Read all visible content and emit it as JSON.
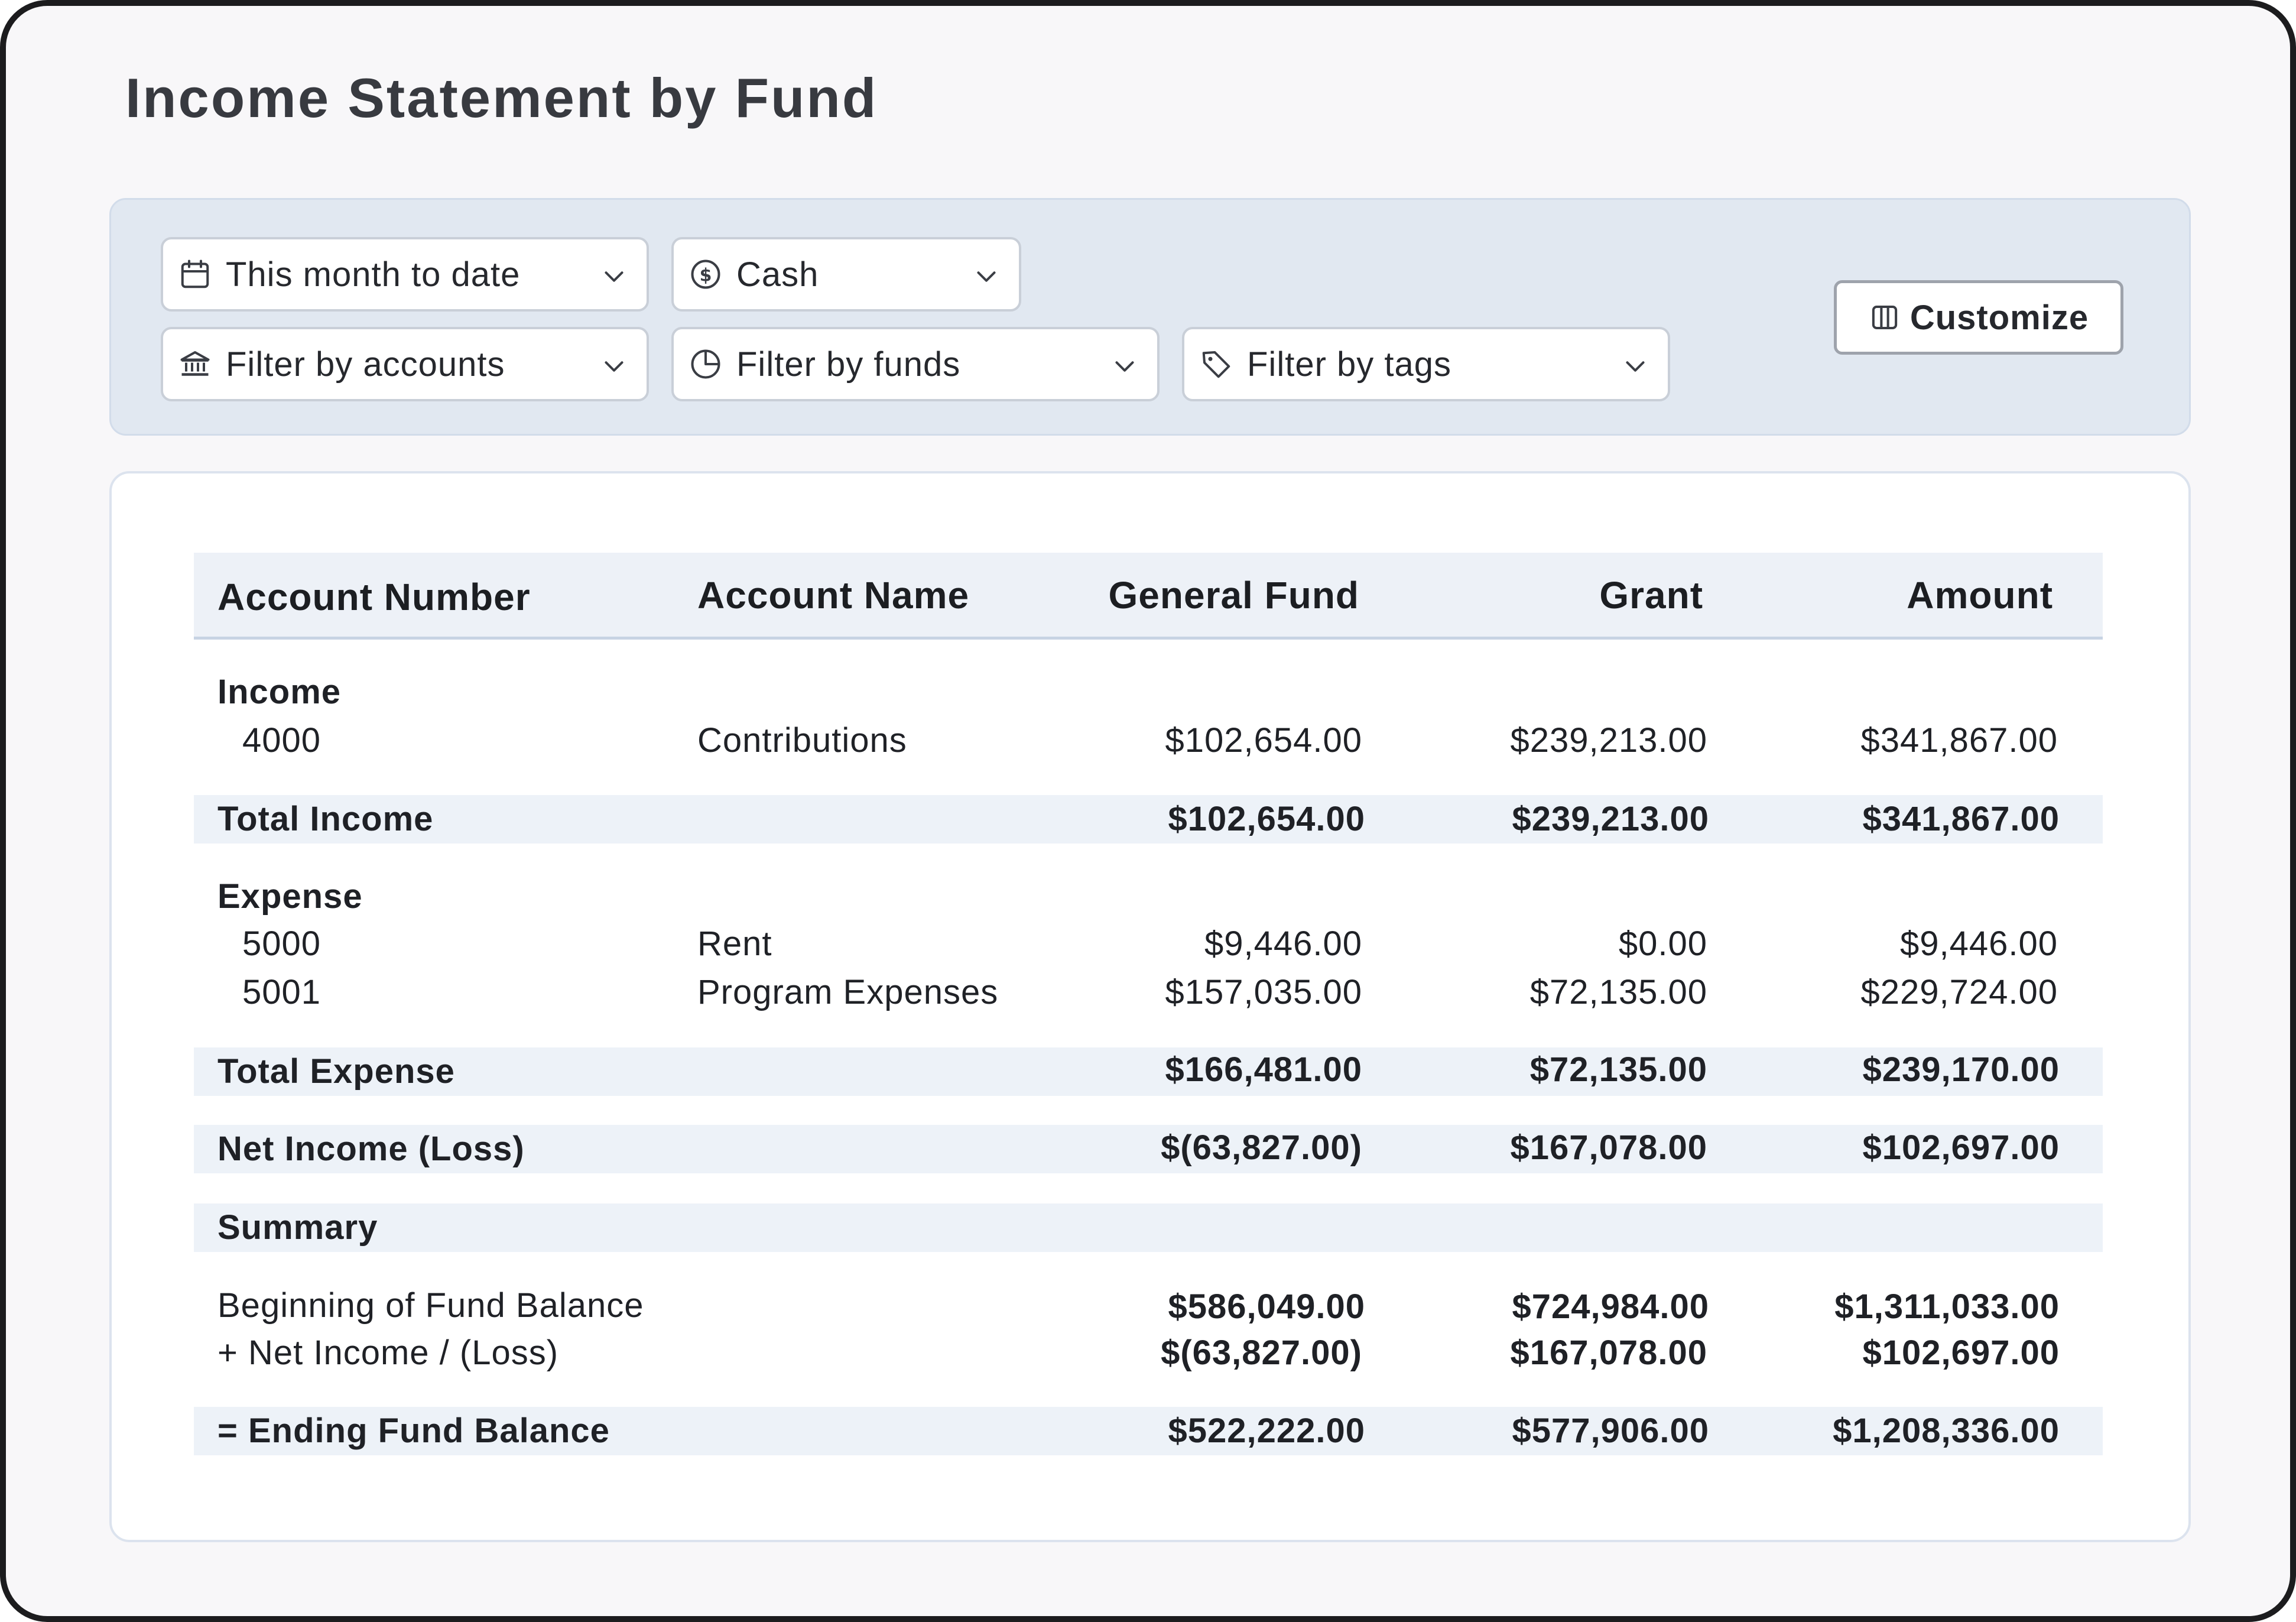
{
  "page_title": "Income Statement by Fund",
  "filters": {
    "date_range": "This month to date",
    "basis": "Cash",
    "accounts": "Filter by accounts",
    "funds": "Filter by funds",
    "tags": "Filter by tags"
  },
  "customize_label": "Customize",
  "table": {
    "headers": {
      "account_number": "Account Number",
      "account_name": "Account Name",
      "general_fund": "General Fund",
      "grant": "Grant",
      "amount": "Amount"
    },
    "income": {
      "label": "Income",
      "rows": [
        {
          "number": "4000",
          "name": "Contributions",
          "general_fund": "$102,654.00",
          "grant": "$239,213.00",
          "amount": "$341,867.00"
        }
      ],
      "total": {
        "label": "Total Income",
        "general_fund": "$102,654.00",
        "grant": "$239,213.00",
        "amount": "$341,867.00"
      }
    },
    "expense": {
      "label": "Expense",
      "rows": [
        {
          "number": "5000",
          "name": "Rent",
          "general_fund": "$9,446.00",
          "grant": "$0.00",
          "amount": "$9,446.00"
        },
        {
          "number": "5001",
          "name": "Program Expenses",
          "general_fund": "$157,035.00",
          "grant": "$72,135.00",
          "amount": "$229,724.00"
        }
      ],
      "total": {
        "label": "Total Expense",
        "general_fund": "$166,481.00",
        "grant": "$72,135.00",
        "amount": "$239,170.00"
      }
    },
    "net_income": {
      "label": "Net Income (Loss)",
      "general_fund": "$(63,827.00)",
      "grant": "$167,078.00",
      "amount": "$102,697.00"
    },
    "summary": {
      "label": "Summary",
      "beginning": {
        "label": "Beginning of Fund Balance",
        "general_fund": "$586,049.00",
        "grant": "$724,984.00",
        "amount": "$1,311,033.00"
      },
      "net": {
        "label": "+ Net Income / (Loss)",
        "general_fund": "$(63,827.00)",
        "grant": "$167,078.00",
        "amount": "$102,697.00"
      },
      "ending": {
        "label": "= Ending Fund Balance",
        "general_fund": "$522,222.00",
        "grant": "$577,906.00",
        "amount": "$1,208,336.00"
      }
    }
  }
}
